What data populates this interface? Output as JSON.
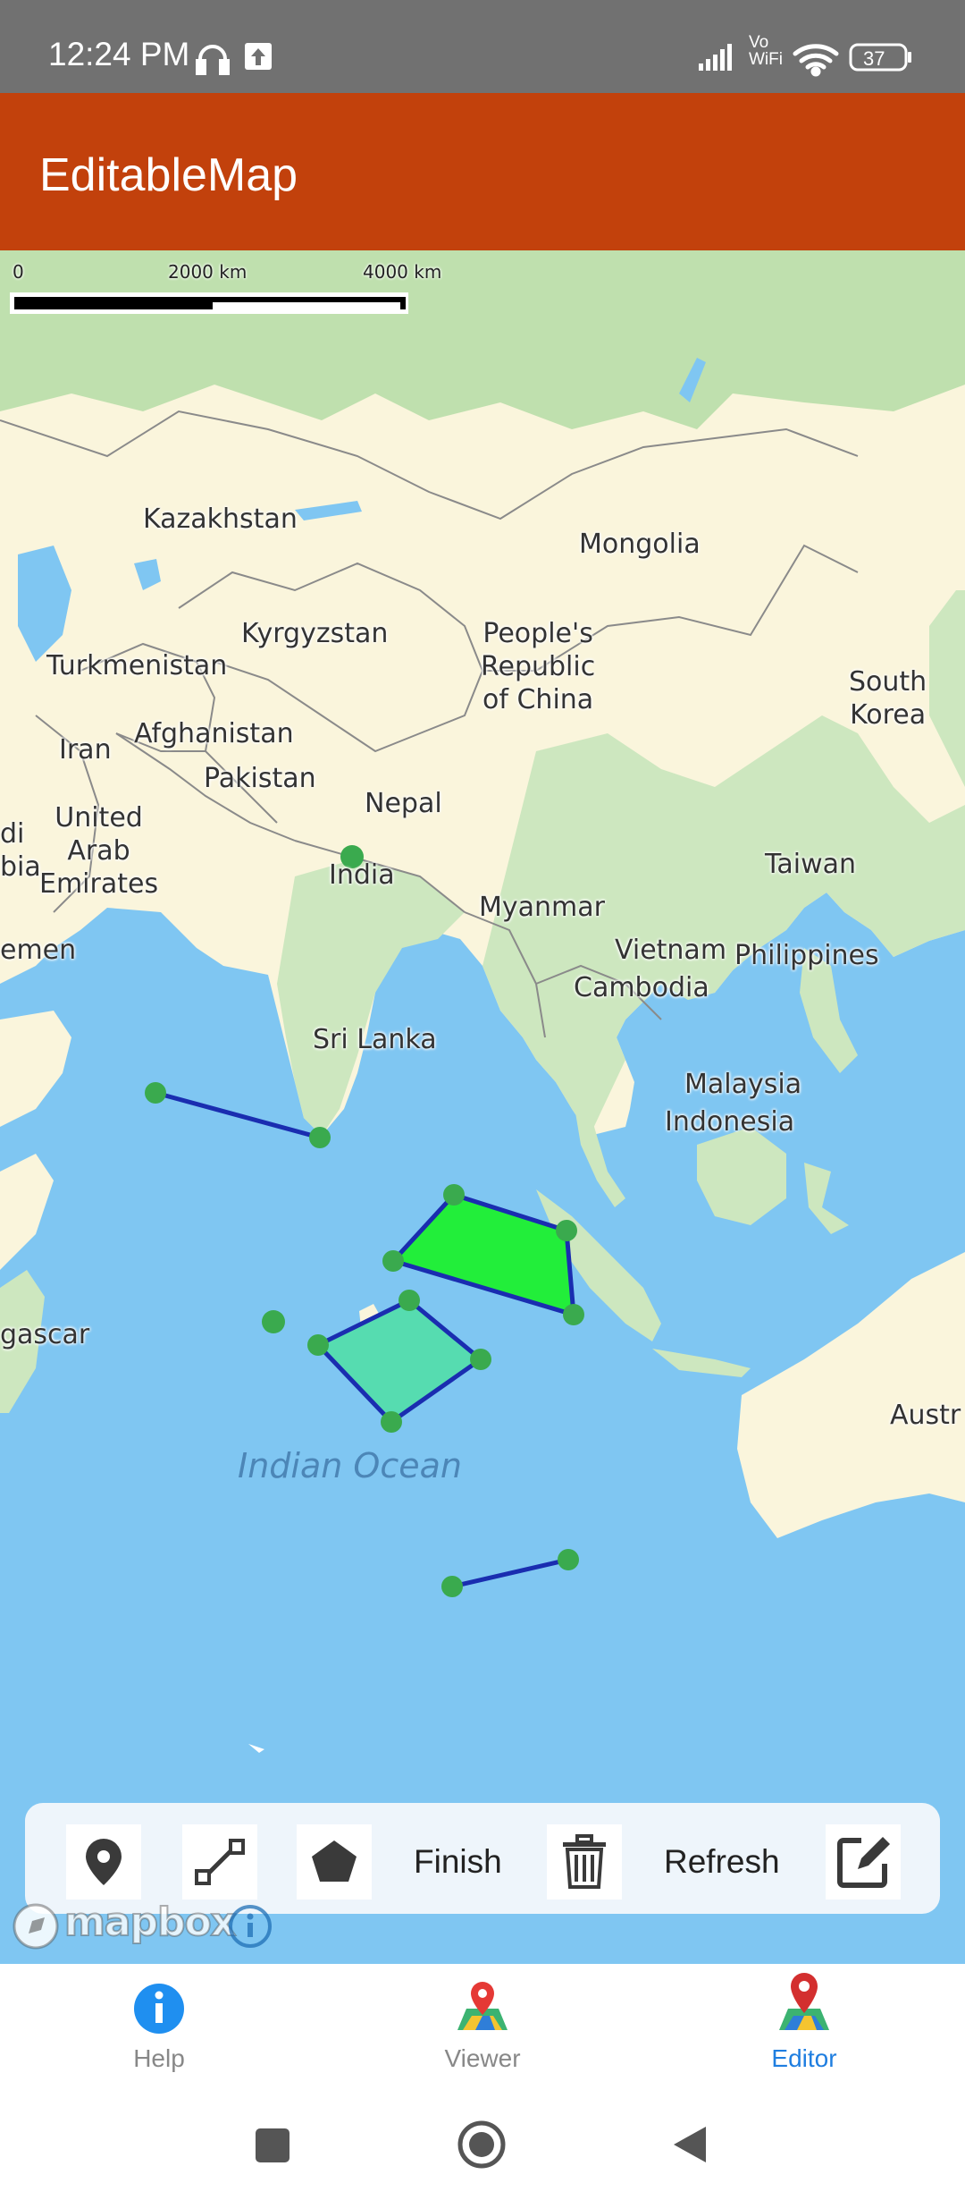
{
  "status_bar": {
    "time": "12:24 PM",
    "network": "Vo WiFi",
    "battery": "37"
  },
  "app_bar": {
    "title": "EditableMap"
  },
  "map": {
    "scale": {
      "label_zero": "0",
      "label_mid": "2000 km",
      "label_end": "4000 km"
    },
    "labels": {
      "kazakhstan": "Kazakhstan",
      "mongolia": "Mongolia",
      "kyrgyzstan": "Kyrgyzstan",
      "china": "People's\nRepublic\nof China",
      "turkmenistan": "Turkmenistan",
      "south_korea": "South\nKorea",
      "iran": "Iran",
      "afghanistan": "Afghanistan",
      "pakistan": "Pakistan",
      "nepal": "Nepal",
      "uae": "United\nArab\nEmirates",
      "saudi": "di\nbia",
      "india": "India",
      "taiwan": "Taiwan",
      "myanmar": "Myanmar",
      "yemen": "emen",
      "vietnam": "Vietnam",
      "philippines": "Philippines",
      "cambodia": "Cambodia",
      "sri_lanka": "Sri Lanka",
      "malaysia": "Malaysia",
      "indonesia": "Indonesia",
      "madagascar": "gascar",
      "australia": "Austr",
      "ocean": "Indian\nOcean"
    },
    "attribution": {
      "logo_text": "mapbox"
    }
  },
  "toolbar": {
    "finish_label": "Finish",
    "refresh_label": "Refresh"
  },
  "bottom_nav": {
    "items": [
      {
        "label": "Help"
      },
      {
        "label": "Viewer"
      },
      {
        "label": "Editor"
      }
    ],
    "active": "Editor"
  },
  "colors": {
    "app_bar": "#c2410c",
    "status_bar": "#717171",
    "ocean": "#7fc6f2",
    "active_nav": "#1f7ee0",
    "vertex": "#3aaa4e",
    "edge": "#1a2db0",
    "polygon_bright": "#22ee3a",
    "polygon_teal": "#56dcb0"
  }
}
